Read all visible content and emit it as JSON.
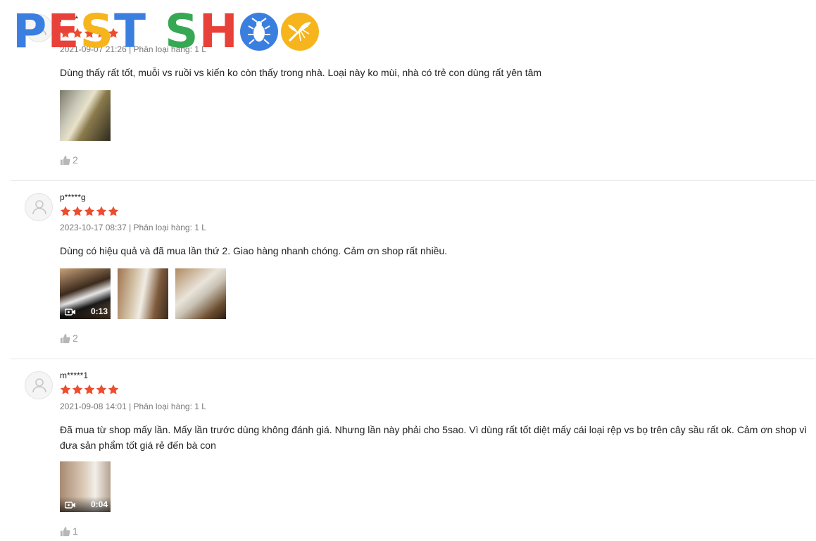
{
  "logo": {
    "letters": [
      "P",
      "E",
      "S",
      "T",
      "S",
      "H"
    ],
    "colors": {
      "blue": "#3a7fe0",
      "red": "#e8413a",
      "yellow": "#f6b51c",
      "green": "#36a853"
    },
    "icons": [
      "mosquito-icon",
      "cockroach-icon",
      "mosquito-icon"
    ]
  },
  "theme": {
    "star_color": "#ee4d2d",
    "divider": "#e8e8e8"
  },
  "reviews": [
    {
      "username": "l*****",
      "meta": "2021-09-07 21:26 | Phân loại hàng: 1 L",
      "comment": "Dùng thấy rất tốt, muỗi vs ruồi vs kiến ko còn thấy trong nhà. Loại này ko mùi, nhà có trẻ con dùng rất yên tâm",
      "rating": 5,
      "likes": "2"
    },
    {
      "username": "p*****g",
      "meta": "2023-10-17 08:37 | Phân loại hàng: 1 L",
      "comment": "Dùng có hiệu quả và đã mua lần thứ 2. Giao hàng nhanh chóng. Cảm ơn shop rất nhiều.",
      "rating": 5,
      "video_duration": "0:13",
      "likes": "2"
    },
    {
      "username": "m*****1",
      "meta": "2021-09-08 14:01 | Phân loại hàng: 1 L",
      "comment": "Đã mua từ shop mấy lần. Mấy lần trước dùng không đánh giá. Nhưng lần này phải cho 5sao. Vì dùng rất tốt diệt mấy cái loại rệp vs bọ trên cây sầu rất ok. Cảm ơn shop vì đưa sản phẩm tốt giá rẻ đến bà con",
      "rating": 5,
      "video_duration": "0:04",
      "likes": "1"
    }
  ]
}
